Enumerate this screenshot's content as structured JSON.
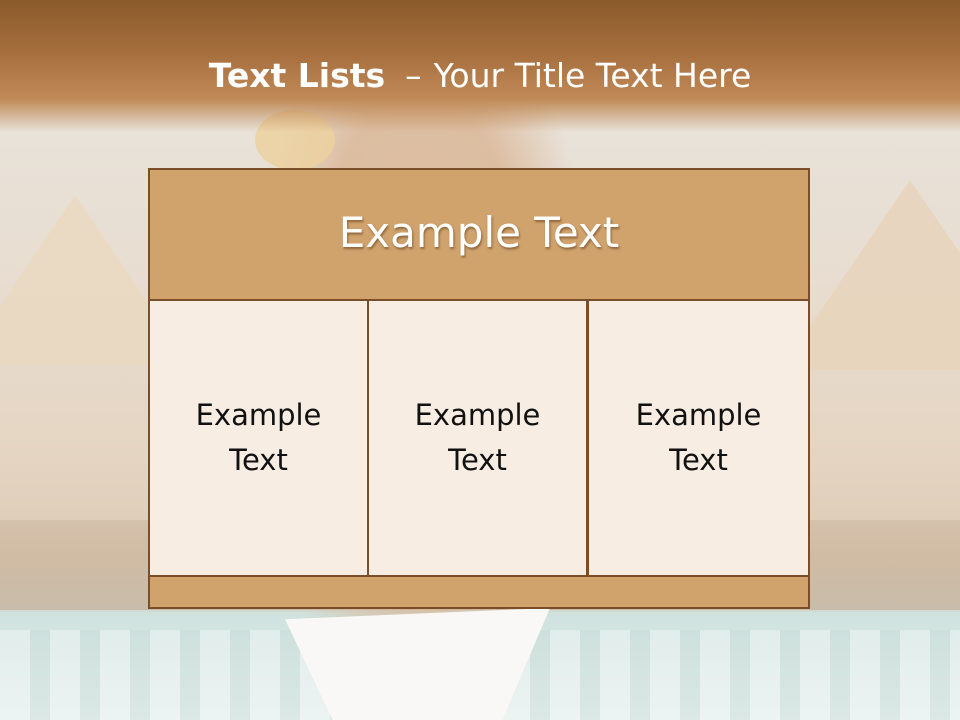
{
  "slide": {
    "title_bold": "Text Lists",
    "title_dash": "–",
    "title_rest": "Your Title Text Here"
  },
  "table": {
    "header": "Example Text",
    "cells": [
      "Example Text",
      "Example Text",
      "Example Text"
    ]
  },
  "colors": {
    "header_band": "#a66e3d",
    "table_accent": "#d0a26c",
    "table_border": "#7a4e28",
    "cell_fill": "#f7ede2"
  }
}
